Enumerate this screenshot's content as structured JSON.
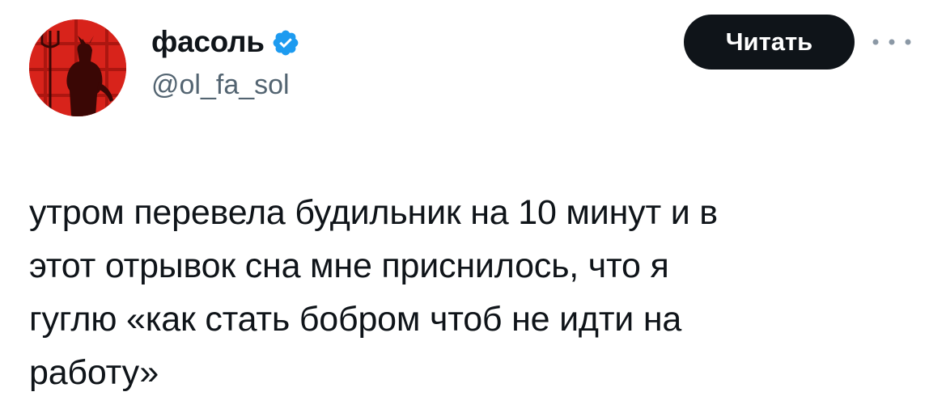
{
  "author": {
    "display_name": "фасоль",
    "handle": "@ol_fa_sol",
    "verified": true,
    "avatar_icon": "devil-silhouette-avatar",
    "avatar_bg_color": "#d8231b"
  },
  "actions": {
    "follow_label": "Читать",
    "more_icon": "more-dots-icon"
  },
  "post": {
    "text": "утром перевела будильник на 10 минут и в\nэтот отрывок сна мне приснилось, что я\nгуглю «как стать бобром чтоб не идти на\nработу»"
  },
  "colors": {
    "verified": "#1d9bf0",
    "button_bg": "#0f1419",
    "handle": "#536471"
  }
}
